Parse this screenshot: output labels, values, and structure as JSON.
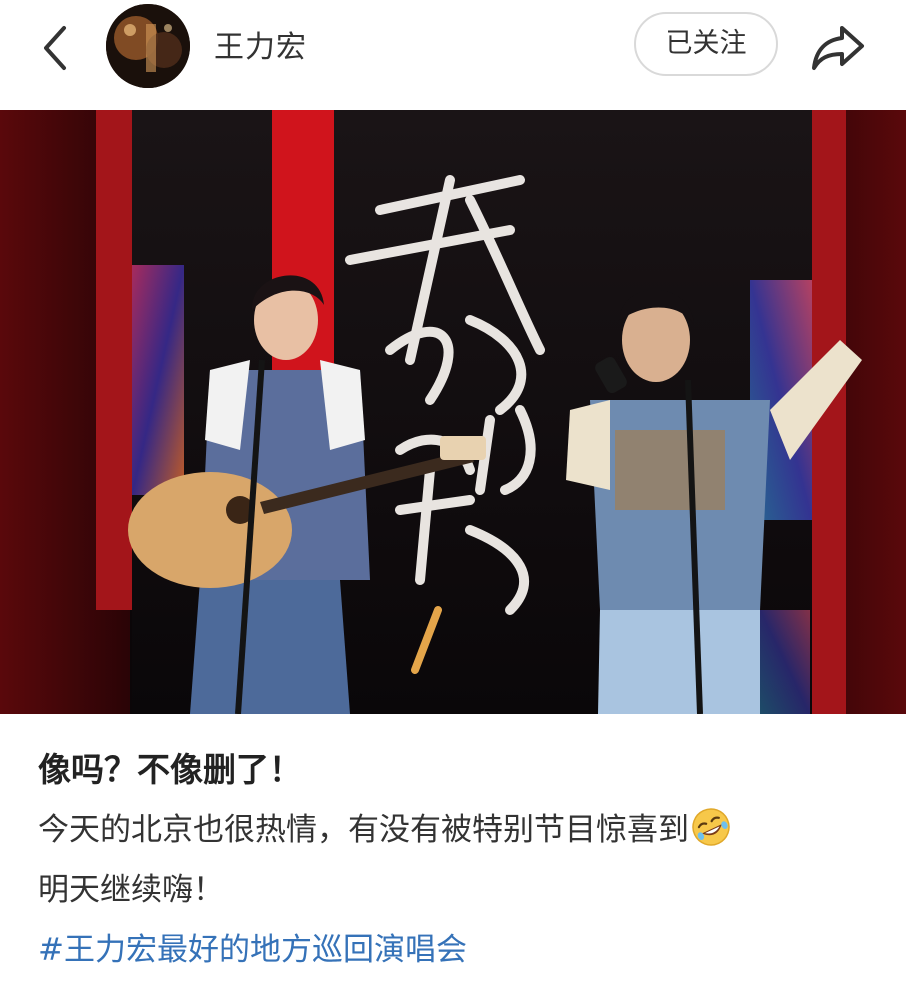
{
  "header": {
    "back_icon": "chevron-left-icon",
    "avatar": "user-avatar",
    "username": "王力宏",
    "follow_label": "已关注",
    "share_icon": "share-icon"
  },
  "photo": {
    "stage_text": "最好的地方"
  },
  "post": {
    "headline": "像吗？不像删了！",
    "line1": "今天的北京也很热情，有没有被特别节目惊喜到",
    "line1_emoji": "rolling-on-floor-laughing-emoji",
    "line2": "明天继续嗨！",
    "hashtag": "#王力宏最好的地方巡回演唱会"
  },
  "colors": {
    "hashtag": "#3572b8",
    "stage_red": "#c8151c",
    "background": "#ffffff"
  }
}
